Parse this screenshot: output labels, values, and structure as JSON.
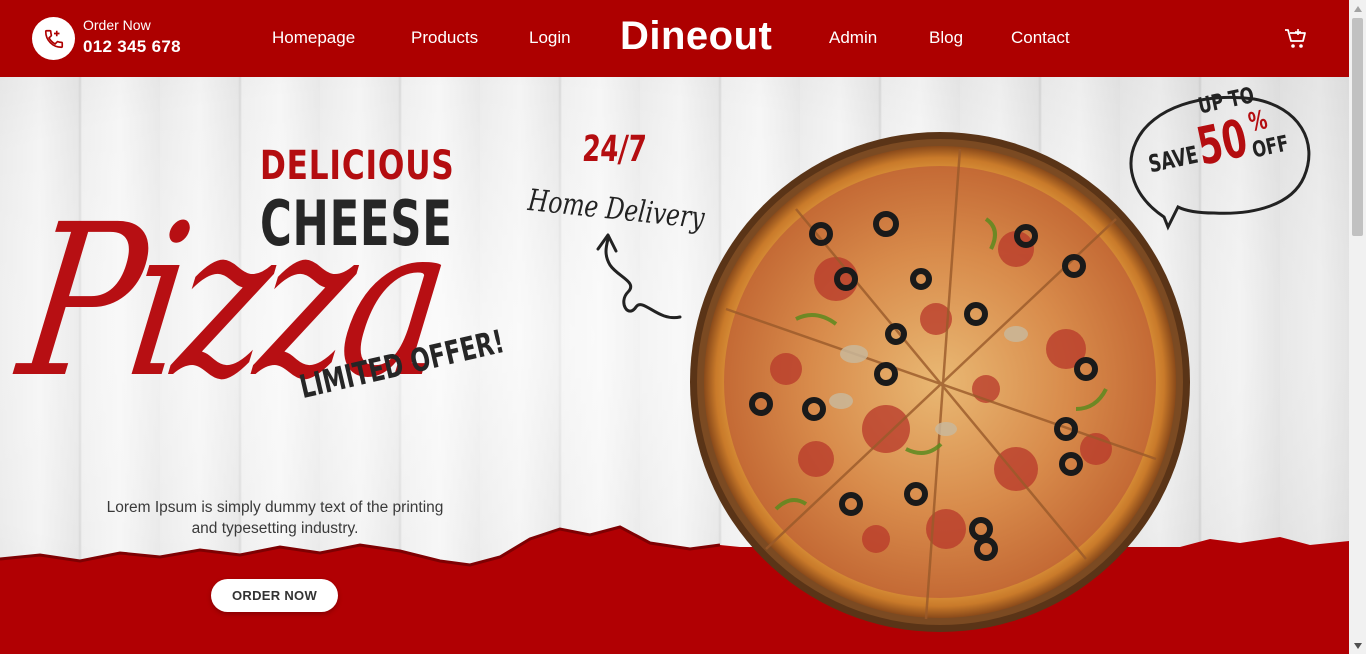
{
  "header": {
    "order_label": "Order Now",
    "order_phone": "012 345 678",
    "brand": "Dineout",
    "nav": [
      {
        "label": "Homepage"
      },
      {
        "label": "Products"
      },
      {
        "label": "Login"
      },
      {
        "label": "Admin"
      },
      {
        "label": "Blog"
      },
      {
        "label": "Contact"
      }
    ],
    "icons": {
      "phone": "phone-plus-icon",
      "cart": "cart-add-icon"
    }
  },
  "hero": {
    "line1": "DELICIOUS",
    "line2": "CHEESE",
    "script": "Pizza",
    "offer": "LIMITED OFFER!",
    "badge_247": "24/7",
    "delivery": "Home Delivery",
    "promo": {
      "up_to": "UP TO",
      "save": "SAVE",
      "percent": "50",
      "sign": "%",
      "off": "OFF"
    },
    "description": "Lorem Ipsum is simply dummy text of the printing and typesetting industry.",
    "cta": "ORDER NOW"
  },
  "colors": {
    "brand_red": "#ad0000",
    "accent_red": "#b40d10",
    "white": "#ffffff"
  }
}
